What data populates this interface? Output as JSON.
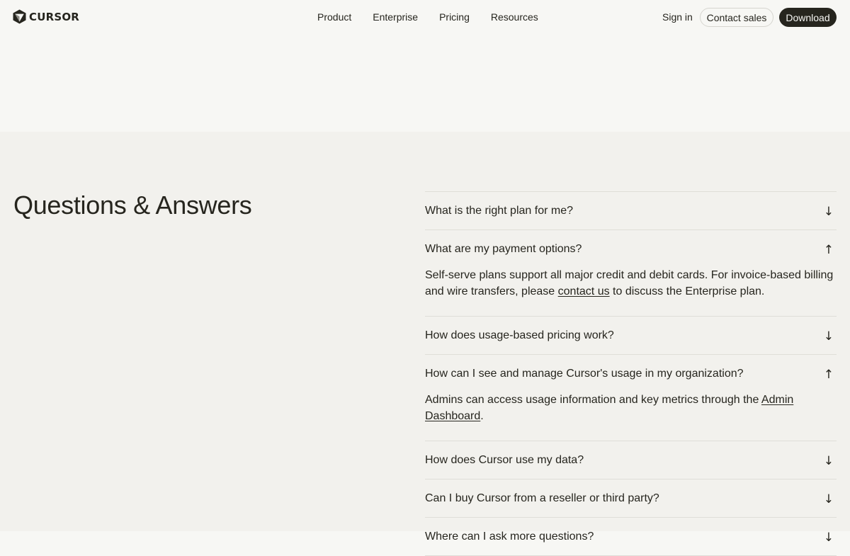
{
  "header": {
    "logo_text": "CURSOR",
    "nav": [
      "Product",
      "Enterprise",
      "Pricing",
      "Resources"
    ],
    "sign_in": "Sign in",
    "contact_sales": "Contact sales",
    "download": "Download"
  },
  "faq": {
    "title": "Questions & Answers",
    "items": [
      {
        "question": "What is the right plan for me?",
        "arrow": "↓",
        "expanded": false
      },
      {
        "question": "What are my payment options?",
        "arrow": "↑",
        "expanded": true,
        "answer_before": "Self-serve plans support all major credit and debit cards. For invoice-based billing and wire transfers, please ",
        "answer_link": "contact us",
        "answer_after": " to discuss the Enterprise plan."
      },
      {
        "question": "How does usage-based pricing work?",
        "arrow": "↓",
        "expanded": false
      },
      {
        "question": "How can I see and manage Cursor's usage in my organization?",
        "arrow": "↑",
        "expanded": true,
        "answer_before": "Admins can access usage information and key metrics through the ",
        "answer_link": "Admin Dashboard",
        "answer_after": "."
      },
      {
        "question": "How does Cursor use my data?",
        "arrow": "↓",
        "expanded": false
      },
      {
        "question": "Can I buy Cursor from a reseller or third party?",
        "arrow": "↓",
        "expanded": false
      },
      {
        "question": "Where can I ask more questions?",
        "arrow": "↓",
        "expanded": false
      }
    ]
  },
  "colors": {
    "page_bg": "#f7f7f4",
    "section_bg": "#f2f1ed",
    "text": "#26251e",
    "divider": "#dfded8",
    "button_dark": "#26251e"
  },
  "icons": {
    "logo": "cursor-cube-icon",
    "collapsed": "arrow-down-icon",
    "expanded": "arrow-up-icon"
  }
}
